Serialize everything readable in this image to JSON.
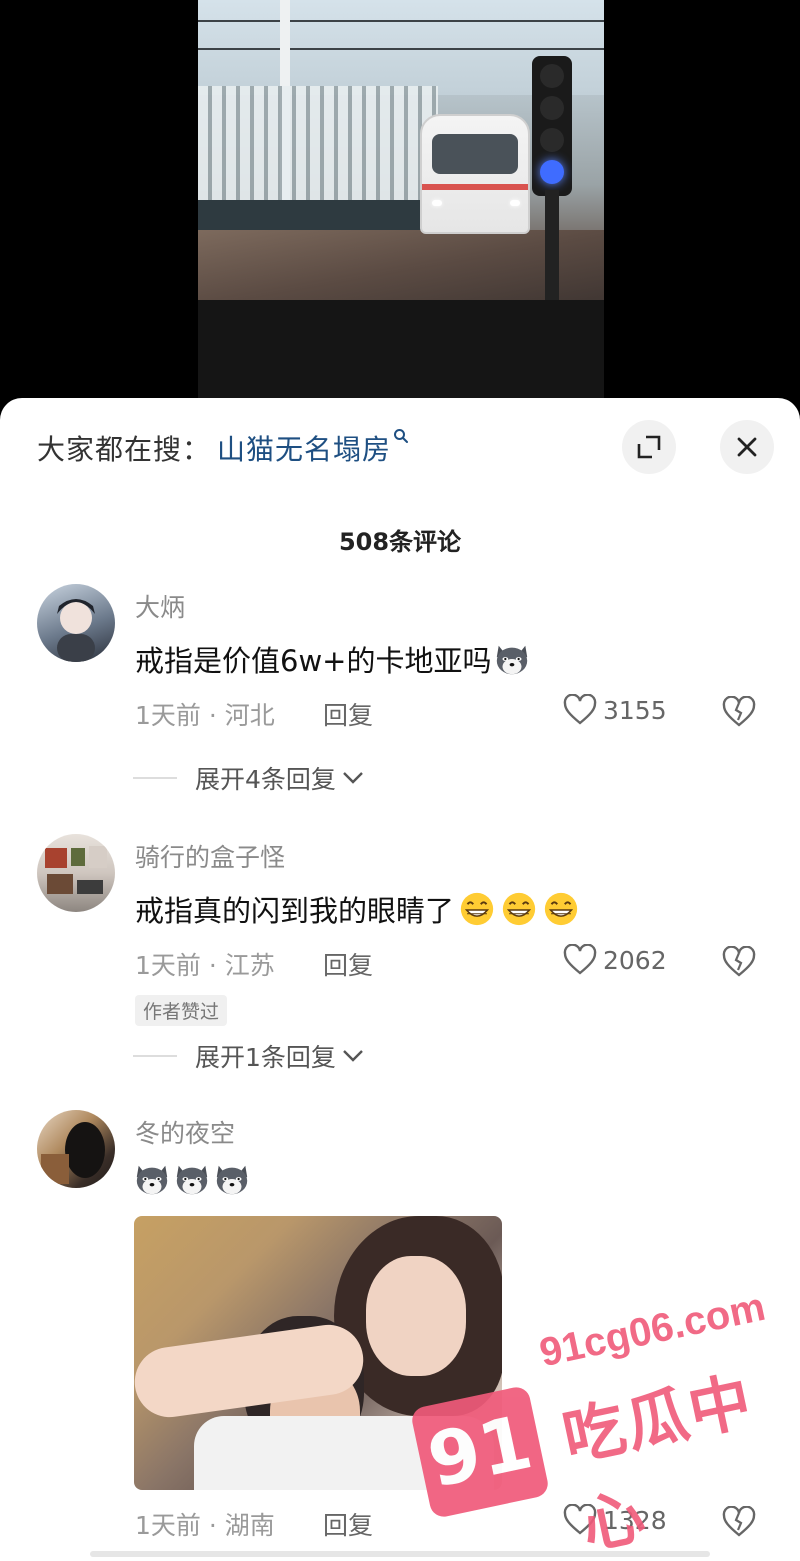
{
  "search_bar": {
    "prefix": "大家都在搜：",
    "term": "山猫无名塌房",
    "icon": "search-icon"
  },
  "header_buttons": {
    "expand_icon": "expand-icon",
    "close_icon": "close-icon"
  },
  "comment_count": "508条评论",
  "comments": [
    {
      "username": "大炳",
      "text": "戒指是价值6w+的卡地亚吗",
      "emoji": "husky-emoji",
      "time_location": "1天前 · 河北",
      "reply_label": "回复",
      "likes": "3155",
      "expand_label": "展开4条回复"
    },
    {
      "username": "骑行的盒子怪",
      "text": "戒指真的闪到我的眼睛了",
      "emoji": "grin-emoji",
      "time_location": "1天前 · 江苏",
      "reply_label": "回复",
      "likes": "2062",
      "author_badge": "作者赞过",
      "expand_label": "展开1条回复"
    },
    {
      "username": "冬的夜空",
      "emoji": "husky-emoji",
      "time_location": "1天前 · 湖南",
      "reply_label": "回复",
      "likes": "1328"
    }
  ],
  "watermark": {
    "badge": "91",
    "domain": "91cg06.com",
    "text": "吃瓜中心"
  },
  "colors": {
    "search_term": "#1e4f82",
    "watermark": "#f05a7a"
  }
}
